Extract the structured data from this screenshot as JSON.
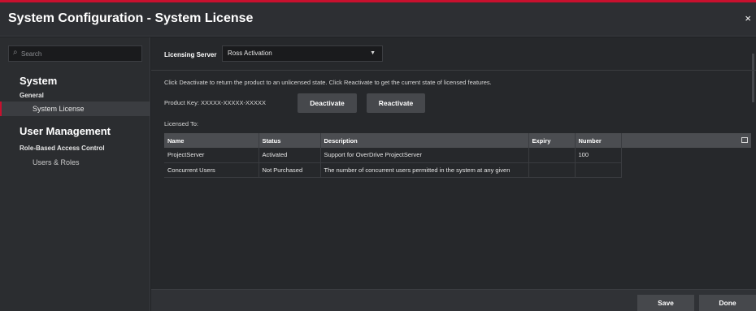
{
  "window": {
    "title": "System Configuration - System License",
    "close_glyph": "×"
  },
  "sidebar": {
    "search": {
      "placeholder": "Search",
      "icon": "search-icon"
    },
    "sections": [
      {
        "label": "System",
        "groups": [
          {
            "label": "General",
            "items": [
              {
                "label": "System License",
                "active": true
              }
            ]
          }
        ]
      },
      {
        "label": "User Management",
        "groups": [
          {
            "label": "Role-Based Access Control",
            "items": [
              {
                "label": "Users & Roles",
                "active": false
              }
            ]
          }
        ]
      }
    ]
  },
  "licensing": {
    "server_label": "Licensing Server",
    "server_value": "Ross Activation",
    "info_text": "Click Deactivate to return the product to an unlicensed state. Click Reactivate to get the current state of licensed features.",
    "product_key": "Product Key: XXXXX-XXXXX-XXXXX",
    "deactivate_label": "Deactivate",
    "reactivate_label": "Reactivate",
    "licensed_to": "Licensed To:"
  },
  "table": {
    "columns": [
      "Name",
      "Status",
      "Description",
      "Expiry",
      "Number",
      ""
    ],
    "rows": [
      [
        "ProjectServer",
        "Activated",
        "Support for OverDrive ProjectServer",
        "",
        "100"
      ],
      [
        "Concurrent Users",
        "Not Purchased",
        "The number of concurrent users permitted in the system at any given",
        "",
        ""
      ]
    ]
  },
  "footer": {
    "save_label": "Save",
    "done_label": "Done"
  },
  "colors": {
    "accent": "#c8102e",
    "background": "#1e2023",
    "panel": "#26282b",
    "button": "#46484c"
  }
}
